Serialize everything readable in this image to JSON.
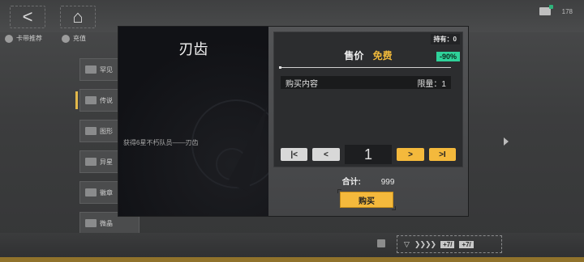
{
  "header": {
    "back_icon": "back-arrow-icon",
    "home_icon": "home-icon",
    "coin_amount": "178"
  },
  "tabs": [
    {
      "label": "卡带推荐"
    },
    {
      "label": "充值"
    }
  ],
  "list_items": [
    {
      "label": "罕见"
    },
    {
      "label": "传说"
    },
    {
      "label": "图形"
    },
    {
      "label": "异星"
    },
    {
      "label": "徽章"
    },
    {
      "label": "微晶"
    }
  ],
  "item": {
    "name": "刃齿",
    "description": "获得6星不朽队员——刃齿"
  },
  "shop": {
    "owned": "持有：0",
    "discount": "-90%",
    "price_label": "售价",
    "price_value": "免费",
    "content_label": "购买内容",
    "limit_label": "限量：1",
    "quantity": "1",
    "btn_first": "K",
    "btn_prev": "<",
    "btn_next": ">",
    "btn_last": ">I",
    "total_label": "合计:",
    "total_value": "999",
    "buy_label": "购买"
  },
  "bottom": {
    "action_text": "+7/",
    "action_text2": "+7/"
  },
  "colors": {
    "accent": "#f4b93c",
    "discount": "#2fd29a",
    "modal_left": "#111216"
  }
}
